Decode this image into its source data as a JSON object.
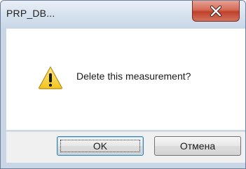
{
  "window": {
    "title": "PRP_DB...",
    "close_icon": "close-icon"
  },
  "dialog": {
    "icon": "warning-icon",
    "message": "Delete this measurement?"
  },
  "buttons": {
    "ok_label": "OK",
    "cancel_label": "Отмена"
  },
  "colors": {
    "close_button": "#c7452f",
    "warning_yellow": "#f7d23c",
    "focus_border": "#3c7fb1"
  }
}
